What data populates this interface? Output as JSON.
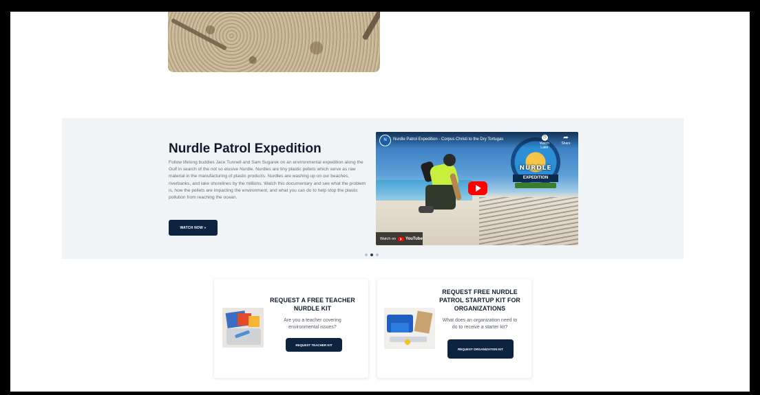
{
  "feature": {
    "title": "Nurdle Patrol Expedition",
    "description": "Follow lifelong buddies Jace Tunnell and Sam Sugarek on an environmental expedition along the Gulf in search of the not so elusive Nurdle. Nurdles are tiny plastic pellets which serve as raw material in the manufacturing of plastic products. Nurdles are washing up on our beaches, riverbanks, and lake shorelines by the millions. Watch this documentary and see what the problem is, how the pellets are impacting the environment, and what you can do to help stop the plastic pollution from reaching the ocean.",
    "button_label": "WATCH NOW »"
  },
  "video": {
    "title": "Nurdle Patrol Expedition - Corpus Christi to the Dry Tortugas",
    "watch_later": "Watch Later",
    "share": "Share",
    "watch_on": "Watch on",
    "youtube": "YouTube",
    "logo_word": "NURDLE",
    "logo_sub": "EXPEDITION"
  },
  "carousel": {
    "count": 3,
    "active_index": 1
  },
  "cards": {
    "teacher": {
      "title": "REQUEST A FREE TEACHER NURDLE KIT",
      "text": "Are you a teacher covering environmental issues?",
      "button": "REQUEST TEACHER KIT"
    },
    "organization": {
      "title": "REQUEST FREE NURDLE PATROL STARTUP KIT FOR ORGANIZATIONS",
      "text": "What does an organization need to do to receive a starter kit?",
      "button": "REQUEST ORGANIZATION KIT"
    }
  },
  "colors": {
    "primary_navy": "#0c2440",
    "heading": "#0f1b2d",
    "band_bg": "#f1f4f7",
    "youtube_red": "#ff0000"
  }
}
